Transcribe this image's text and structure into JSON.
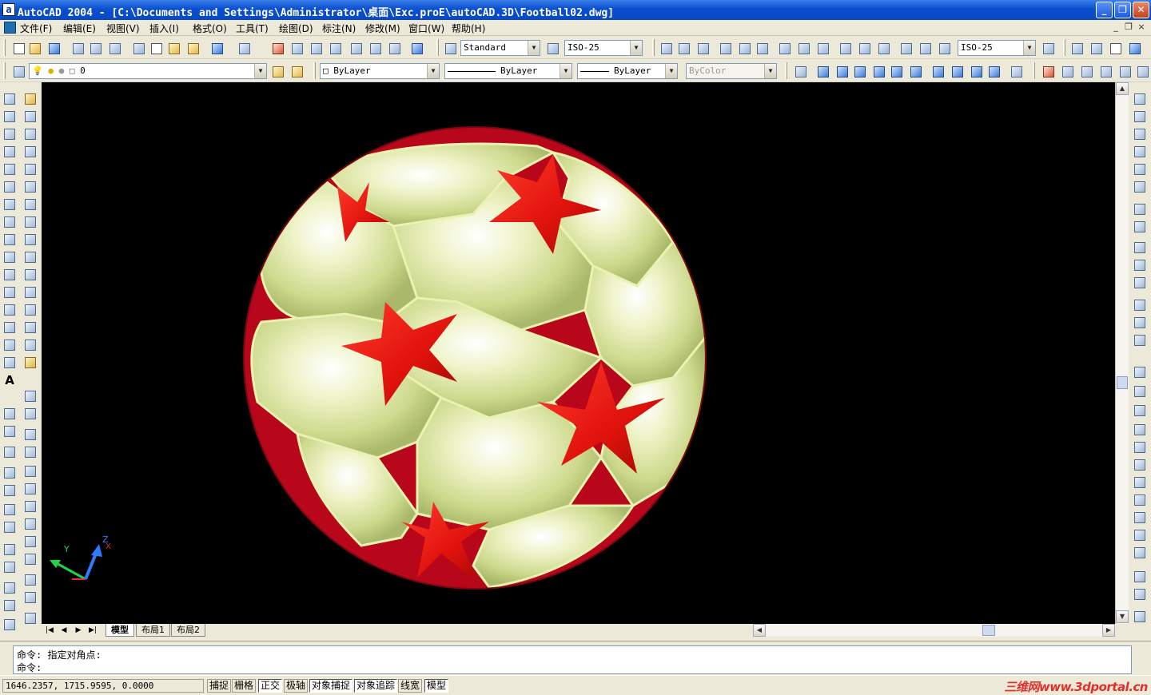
{
  "window": {
    "title": "AutoCAD 2004 - [C:\\Documents and Settings\\Administrator\\桌面\\Exc.proE\\autoCAD.3D\\Football02.dwg]",
    "app_icon_glyph": "a",
    "minimize_glyph": "_",
    "restore_glyph": "❐",
    "close_glyph": "✕"
  },
  "menu": {
    "items": [
      "文件(F)",
      "编辑(E)",
      "视图(V)",
      "插入(I)",
      "格式(O)",
      "工具(T)",
      "绘图(D)",
      "标注(N)",
      "修改(M)",
      "窗口(W)",
      "帮助(H)"
    ],
    "doc_min_glyph": "_",
    "doc_restore_glyph": "❐",
    "doc_close_glyph": "×"
  },
  "toolbar1": {
    "text_style": "Standard",
    "dim_style": "ISO-25",
    "dim_style_right": "ISO-25"
  },
  "toolbar2": {
    "layer": "0",
    "color": "ByLayer",
    "linetype": "ByLayer",
    "lineweight": "ByLayer",
    "plotstyle": "ByColor"
  },
  "ucs": {
    "x": "X",
    "y": "Y",
    "z": "Z"
  },
  "tabs": [
    "模型",
    "布局1",
    "布局2"
  ],
  "command": {
    "line1": "命令:  指定对角点:",
    "line2": "命令:"
  },
  "status": {
    "coords": "1646.2357, 1715.9595, 0.0000",
    "buttons": [
      {
        "label": "捕捉",
        "on": false
      },
      {
        "label": "栅格",
        "on": false
      },
      {
        "label": "正交",
        "on": true
      },
      {
        "label": "极轴",
        "on": false
      },
      {
        "label": "对象捕捉",
        "on": true
      },
      {
        "label": "对象追踪",
        "on": true
      },
      {
        "label": "线宽",
        "on": false
      },
      {
        "label": "模型",
        "on": true
      }
    ],
    "watermark": "三维网www.3dportal.cn"
  },
  "colors": {
    "viewport_bg": "#000000",
    "ball_panel": "#e4eca8",
    "star": "#e8140f",
    "titlebar": "#0a4fd0"
  }
}
